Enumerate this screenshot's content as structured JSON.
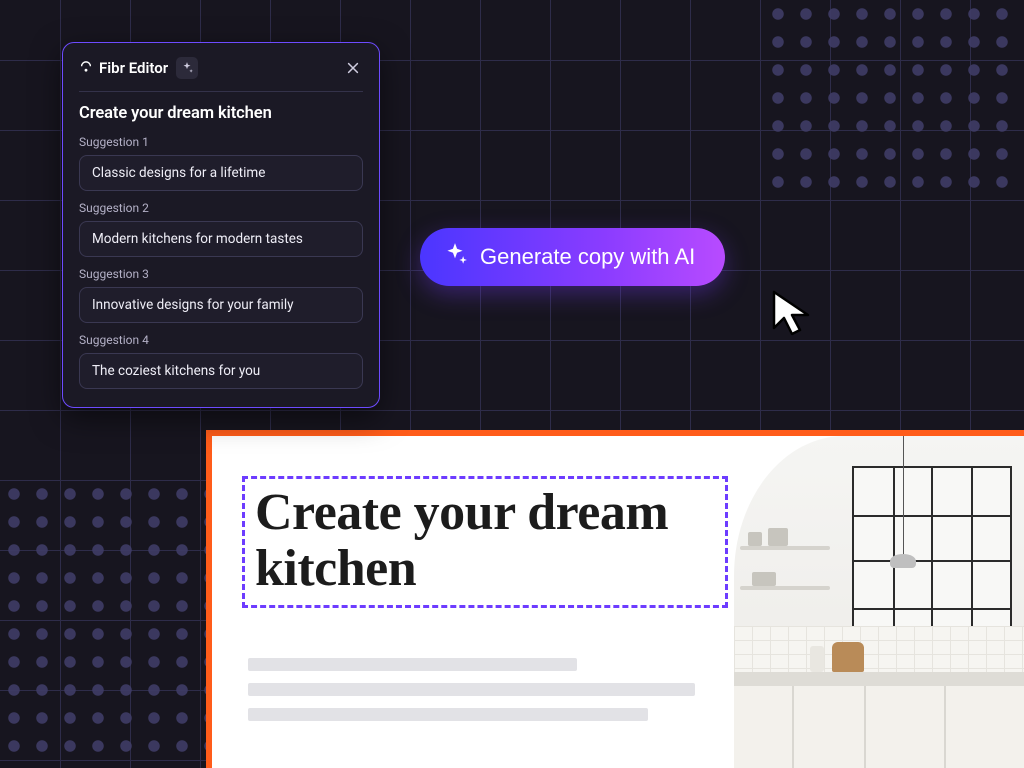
{
  "editor": {
    "brand": "Fibr Editor",
    "title": "Create your dream kitchen",
    "suggestions": [
      {
        "label": "Suggestion 1",
        "text": "Classic designs for a lifetime"
      },
      {
        "label": "Suggestion 2",
        "text": "Modern kitchens for modern tastes"
      },
      {
        "label": "Suggestion 3",
        "text": "Innovative designs for your family"
      },
      {
        "label": "Suggestion 4",
        "text": "The coziest kitchens for you"
      }
    ]
  },
  "generate_button": {
    "label": "Generate copy with AI"
  },
  "page": {
    "headline": "Create your dream kitchen"
  },
  "colors": {
    "accent_orange": "#ff5c1a",
    "accent_purple": "#6d3cff"
  }
}
